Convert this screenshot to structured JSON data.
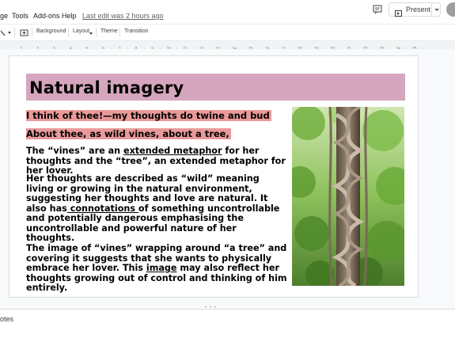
{
  "menubar": {
    "items": [
      "ge",
      "Tools",
      "Add-ons",
      "Help"
    ],
    "last_edit": "Last edit was 2 hours ago",
    "present_label": "Present"
  },
  "toolbar": {
    "background_label": "Background",
    "layout_label": "Layout",
    "theme_label": "Theme",
    "transition_label": "Transition"
  },
  "ruler": {
    "marks": [
      "1",
      "2",
      "3",
      "4",
      "5",
      "6",
      "7",
      "8",
      "9",
      "10",
      "11",
      "12",
      "13",
      "14",
      "15",
      "16",
      "17",
      "18",
      "19",
      "20",
      "21",
      "22",
      "23",
      "24",
      "25"
    ]
  },
  "slide": {
    "title": "Natural imagery",
    "quote_lines": [
      "I think of thee!—my thoughts do twine and bud",
      "About thee, as wild vines, about a tree,"
    ],
    "paragraph1": {
      "pre": "The “vines” are an ",
      "link": "extended metaphor",
      "post": " for her thoughts and the “tree”, an extended metaphor for her lover."
    },
    "paragraph2": {
      "pre": "Her thoughts are described as “wild” meaning living or growing in the natural environment, suggesting her thoughts and love are natural. It also has",
      "link": " connotations ",
      "post": "of something uncontrollable and potentially dangerous emphasising the uncontrollable and powerful nature of her thoughts."
    },
    "paragraph3": {
      "pre": "The image of “vines” wrapping around “a tree” and covering it suggests that she wants to physically embrace her lover. This ",
      "link": "image",
      "post": " may also reflect her thoughts growing out of control and thinking of him entirely."
    }
  },
  "notes": {
    "label": "otes"
  },
  "colors": {
    "title_bg": "#d5a6bd",
    "highlight": "#ea9999"
  }
}
